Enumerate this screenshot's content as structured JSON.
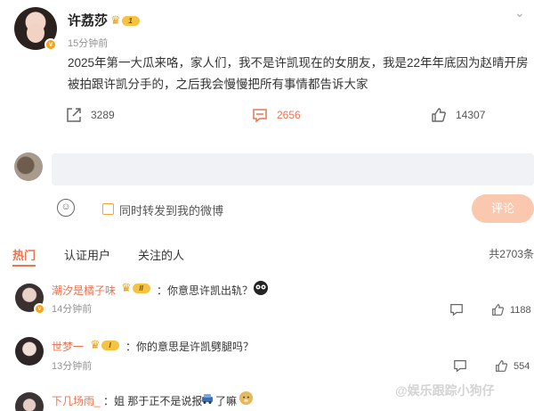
{
  "post": {
    "author": "许荔莎",
    "level": "1",
    "time": "15分钟前",
    "text": "2025年第一大瓜来咯，家人们，我不是许凯现在的女朋友，我是22年年底因为赵晴开房被拍跟许凯分手的，之后我会慢慢把所有事情都告诉大家",
    "repost_count": "3289",
    "comment_count": "2656",
    "like_count": "14307"
  },
  "composer": {
    "placeholder": "",
    "repost_label": "同时转发到我的微博",
    "submit_label": "评论"
  },
  "tabs": {
    "hot": "热门",
    "verified": "认证用户",
    "following": "关注的人",
    "total": "共2703条"
  },
  "comments": [
    {
      "user": "潮汐是橘子味",
      "level": "II",
      "text": "：你意思许凯出轨？",
      "time": "14分钟前",
      "likes": "1188"
    },
    {
      "user": "世梦一",
      "level": "I",
      "text": "：你的意思是许凯劈腿吗？",
      "time": "13分钟前",
      "likes": "554"
    },
    {
      "user": "下几场雨_",
      "level": "",
      "text": "：姐 那于正不是说报",
      "text_tail": "了嘛",
      "time": "",
      "likes": ""
    }
  ],
  "watermark": "@娱乐跟踪小狗仔",
  "colors": {
    "accent": "#eb7350",
    "button_disabled": "#f9c8ae",
    "badge": "#f5c242"
  },
  "icons": [
    "more-icon",
    "repost-icon",
    "comment-icon",
    "like-icon",
    "emoji-icon",
    "crown-icon",
    "car-emoji-icon",
    "doge-emoji-icon",
    "panda-emoji-icon"
  ]
}
